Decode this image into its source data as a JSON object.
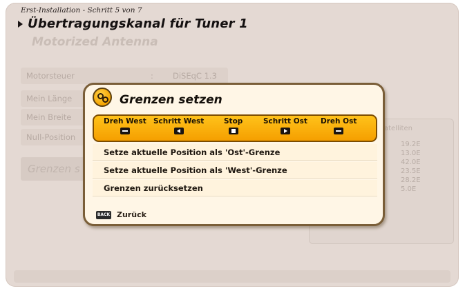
{
  "header": {
    "breadcrumb": "Erst-Installation - Schritt 5 von 7",
    "title": "Übertragungskanal für Tuner 1",
    "subtitle": "Motorized Antenna"
  },
  "settings": {
    "rows": [
      {
        "label": "Motorsteuer",
        "separator": ":",
        "value": "DiSEqC 1.3"
      },
      {
        "label": "Mein Länge",
        "separator": "",
        "value": ""
      },
      {
        "label": "Mein Breite",
        "separator": "",
        "value": ""
      },
      {
        "label": "Null-Position",
        "separator": "",
        "value": ""
      }
    ],
    "grenzen_label": "Grenzen s"
  },
  "satellites": {
    "header": "atelliten",
    "items": [
      "19.2E",
      "13.0E",
      "42.0E",
      "23.5E",
      "28.2E",
      "5.0E"
    ]
  },
  "popup": {
    "title": "Grenzen setzen",
    "buttons": [
      {
        "label": "Dreh West",
        "icon": "minus-key-icon"
      },
      {
        "label": "Schritt West",
        "icon": "left-arrow-key-icon"
      },
      {
        "label": "Stop",
        "icon": "stop-key-icon"
      },
      {
        "label": "Schritt Ost",
        "icon": "right-arrow-key-icon"
      },
      {
        "label": "Dreh Ost",
        "icon": "minus-key-icon"
      }
    ],
    "menu": [
      "Setze aktuelle Position als 'Ost'-Grenze",
      "Setze aktuelle Position als 'West'-Grenze",
      "Grenzen zurücksetzen"
    ],
    "back_key": "BACK",
    "back_label": "Zurück"
  },
  "colors": {
    "accent": "#f5a400",
    "popup_border": "#7a5e38",
    "panel_bg": "#e4d9d3"
  }
}
